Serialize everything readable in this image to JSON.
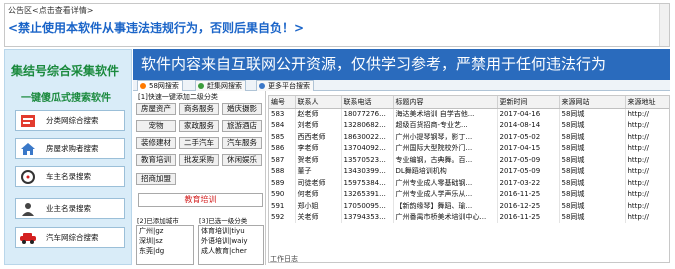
{
  "notice": {
    "label": "公告区<点击查看详情>",
    "warning": "<禁止使用本软件从事违法违规行为，否则后果自负！>"
  },
  "sidebar": {
    "title": "集结号综合采集软件",
    "subtitle": "一键傻瓜式搜索软件",
    "items": [
      {
        "label": "分类网综合搜索",
        "icon": "classified-icon"
      },
      {
        "label": "房屋求购者搜索",
        "icon": "house-icon"
      },
      {
        "label": "车主名录搜索",
        "icon": "car-owner-icon"
      },
      {
        "label": "业主名录搜索",
        "icon": "owner-icon"
      },
      {
        "label": "汽车网综合搜索",
        "icon": "car-icon"
      }
    ]
  },
  "banner": "软件内容来自互联网公开资源，仅供学习参考，严禁用于任何违法行为",
  "tabs": [
    {
      "label": "58网搜索",
      "icon": "58-icon",
      "color": "#ff7a00"
    },
    {
      "label": "赶集网搜索",
      "icon": "ganji-icon",
      "color": "#3c9c3c"
    },
    {
      "label": "更多平台搜索",
      "icon": "more-platforms-icon",
      "color": "#3c78c8"
    }
  ],
  "categories": {
    "header": "[1]快速一键添加二级分类",
    "buttons": [
      "房屋资产",
      "商务服务",
      "婚庆摄影",
      "宠物",
      "家政服务",
      "旅游酒店",
      "装修建材",
      "二手汽车",
      "汽车服务",
      "教育培训",
      "批发采购",
      "休闲娱乐",
      "招商加盟"
    ],
    "selected": "教育培训",
    "city_header": "[2]已添加城市",
    "cities": [
      "广州|gz",
      "深圳|sz",
      "东莞|dg"
    ],
    "sub_header": "[3]已选一级分类",
    "subs": [
      "体育培训|tiyu",
      "外语培训|waiy",
      "成人教育|cher"
    ]
  },
  "table": {
    "columns": [
      "编号",
      "联系人",
      "联系电话",
      "标题内容",
      "更新时间",
      "来源网站",
      "来源地址"
    ],
    "rows": [
      [
        "583",
        "赵老师",
        "18077276...",
        "海达美术培训 自学吉他...",
        "2017-04-16",
        "58同城",
        "http://"
      ],
      [
        "584",
        "刘老师",
        "13280682...",
        "超级百货招商-专业艺...",
        "2014-08-14",
        "58同城",
        "http://"
      ],
      [
        "585",
        "西西老师",
        "18630022...",
        "广州小提琴钢琴，影丁...",
        "2017-05-02",
        "58同城",
        "http://"
      ],
      [
        "586",
        "李老师",
        "13704092...",
        "广州国际大型院校外门...",
        "2017-04-15",
        "58同城",
        "http://"
      ],
      [
        "587",
        "贺老师",
        "13570523...",
        "专业编钢，古典舞。百...",
        "2017-05-09",
        "58同城",
        "http://"
      ],
      [
        "588",
        "董子",
        "13430399...",
        "DL舞蹈培训机构",
        "2017-05-09",
        "58同城",
        "http://"
      ],
      [
        "589",
        "司徒老师",
        "15975384...",
        "广州专业成人零基础钢...",
        "2017-03-22",
        "58同城",
        "http://"
      ],
      [
        "590",
        "何老师",
        "13265391...",
        "广州专业成人学声乐从...",
        "2016-11-25",
        "58同城",
        "http://"
      ],
      [
        "591",
        "郑小姐",
        "17050095...",
        "【新韵缘琴】舞蹈、瑜...",
        "2016-12-25",
        "58同城",
        "http://"
      ],
      [
        "592",
        "关老师",
        "13794353...",
        "广州番禺市桥美术培训中心...",
        "2016-11-25",
        "58同城",
        "http://"
      ]
    ]
  },
  "status": "工作日志"
}
